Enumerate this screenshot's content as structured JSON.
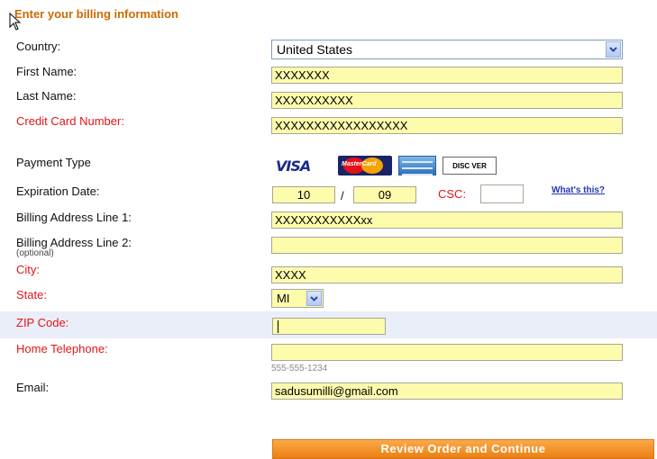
{
  "heading": "Enter your billing information",
  "labels": {
    "country": "Country:",
    "first_name": "First Name:",
    "last_name": "Last Name:",
    "credit_card": "Credit Card Number:",
    "payment_type": "Payment Type",
    "expiration": "Expiration Date:",
    "address1": "Billing Address Line 1:",
    "address2": "Billing Address Line 2:",
    "address2_note": "(optional)",
    "city": "City:",
    "state": "State:",
    "zip": "ZIP Code:",
    "phone": "Home Telephone:",
    "email": "Email:"
  },
  "values": {
    "country": "United States",
    "first_name": "XXXXXXX",
    "last_name": "XXXXXXXXXX",
    "credit_card": "XXXXXXXXXXXXXXXXX",
    "exp_month": "10",
    "exp_separator": "/",
    "exp_year": "09",
    "csc_label": "CSC:",
    "csc": "",
    "address1": "XXXXXXXXXXXxx",
    "address2": "",
    "city": "XXXX",
    "state": "MI",
    "zip": "",
    "phone": "",
    "email": "sadusumilli@gmail.com"
  },
  "phone_hint": "555-555-1234",
  "whats_this": "What's this?",
  "payment_cards": {
    "visa": "VISA",
    "mastercard": "MasterCard",
    "discover": "DISC VER"
  },
  "submit_label": "Review Order and Continue",
  "colors": {
    "heading": "#cc6a00",
    "required": "#e31515",
    "field_bg": "#fdfcad",
    "zip_row_bg": "#e9eef9",
    "button": "#ec7f10"
  }
}
